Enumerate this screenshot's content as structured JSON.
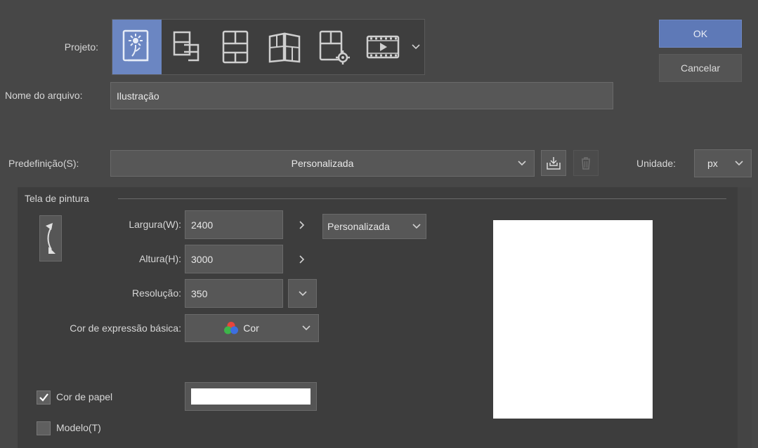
{
  "project": {
    "label": "Projeto:",
    "types": [
      {
        "icon": "illustration-icon",
        "selected": true
      },
      {
        "icon": "webtoon-icon",
        "selected": false
      },
      {
        "icon": "comic-page-icon",
        "selected": false
      },
      {
        "icon": "book-spread-icon",
        "selected": false
      },
      {
        "icon": "page-settings-icon",
        "selected": false
      },
      {
        "icon": "animation-icon",
        "selected": false
      }
    ]
  },
  "buttons": {
    "ok": "OK",
    "cancel": "Cancelar"
  },
  "filename": {
    "label": "Nome do arquivo:",
    "value": "Ilustração"
  },
  "preset": {
    "label": "Predefinição(S):",
    "value": "Personalizada"
  },
  "unit": {
    "label": "Unidade:",
    "value": "px"
  },
  "canvas": {
    "section_title": "Tela de pintura",
    "width_label": "Largura(W):",
    "width_value": "2400",
    "height_label": "Altura(H):",
    "height_value": "3000",
    "size_preset": "Personalizada",
    "resolution_label": "Resolução:",
    "resolution_value": "350",
    "color_mode_label": "Cor de expressão básica:",
    "color_mode_value": "Cor",
    "paper_color_label": "Cor de papel",
    "paper_color_checked": true,
    "paper_color": "#ffffff",
    "template_label": "Modelo(T)",
    "template_checked": false
  },
  "colors": {
    "accent": "#6b86c2",
    "ok_button": "#5e79b7",
    "background": "#474747"
  }
}
